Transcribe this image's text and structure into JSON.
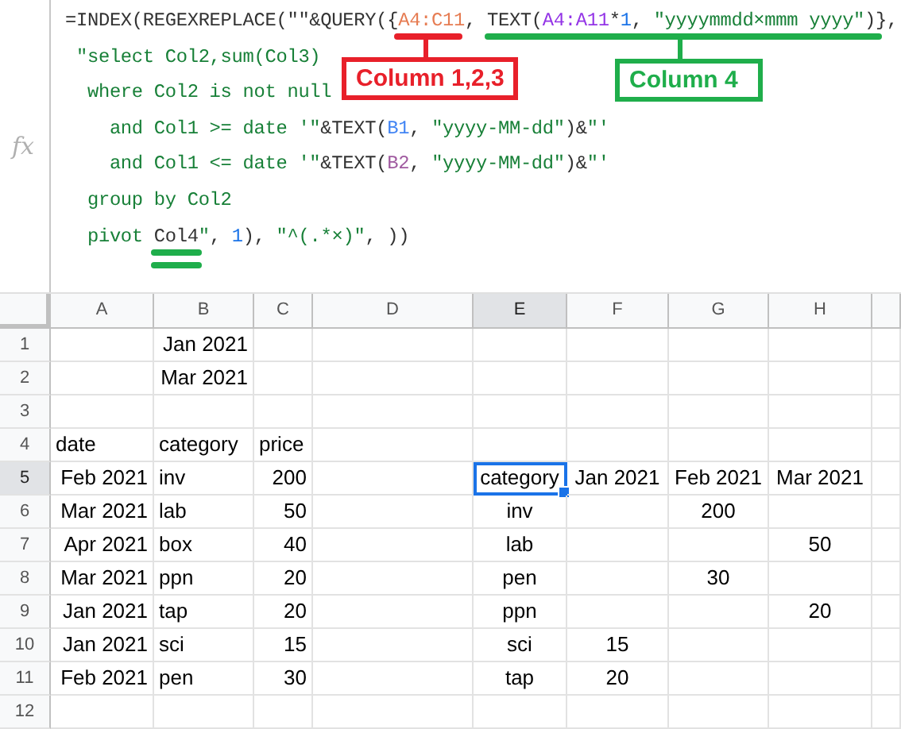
{
  "formula_bar": {
    "icon_label": "fx",
    "lines": [
      [
        {
          "kind": "text",
          "text": "=INDEX(REGEXREPLACE(\"\"&QUERY({"
        },
        {
          "kind": "range",
          "text": "A4:C11",
          "color": "#e67c52"
        },
        {
          "kind": "text",
          "text": ", TEXT("
        },
        {
          "kind": "range",
          "text": "A4:A11",
          "color": "#9334e6"
        },
        {
          "kind": "text",
          "text": "*"
        },
        {
          "kind": "number",
          "text": "1"
        },
        {
          "kind": "text",
          "text": ", "
        },
        {
          "kind": "string",
          "text": "\"yyyymmdd×mmm yyyy\""
        },
        {
          "kind": "text",
          "text": ")},"
        }
      ],
      [
        {
          "kind": "string",
          "text": " \"select Col2,sum(Col3)"
        }
      ],
      [
        {
          "kind": "string",
          "text": "  where Col2 is not null"
        }
      ],
      [
        {
          "kind": "string",
          "text": "    and Col1 >= date '\""
        },
        {
          "kind": "text",
          "text": "&TEXT("
        },
        {
          "kind": "range",
          "text": "B1",
          "color": "#4285f4"
        },
        {
          "kind": "text",
          "text": ", "
        },
        {
          "kind": "string",
          "text": "\"yyyy-MM-dd\""
        },
        {
          "kind": "text",
          "text": ")&"
        },
        {
          "kind": "string",
          "text": "\"'"
        }
      ],
      [
        {
          "kind": "string",
          "text": "    and Col1 <= date '\""
        },
        {
          "kind": "text",
          "text": "&TEXT("
        },
        {
          "kind": "range",
          "text": "B2",
          "color": "#a05ba0"
        },
        {
          "kind": "text",
          "text": ", "
        },
        {
          "kind": "string",
          "text": "\"yyyy-MM-dd\""
        },
        {
          "kind": "text",
          "text": ")&"
        },
        {
          "kind": "string",
          "text": "\"'"
        }
      ],
      [
        {
          "kind": "string",
          "text": "  group by Col2"
        }
      ],
      [
        {
          "kind": "string",
          "text": "  pivot "
        },
        {
          "kind": "text",
          "text": "Col4"
        },
        {
          "kind": "string",
          "text": "\""
        },
        {
          "kind": "text",
          "text": ", "
        },
        {
          "kind": "number",
          "text": "1"
        },
        {
          "kind": "text",
          "text": "), "
        },
        {
          "kind": "string",
          "text": "\"^(.*×)\""
        },
        {
          "kind": "text",
          "text": ", ))"
        }
      ]
    ],
    "annotations": [
      {
        "label": "Column 1,2,3",
        "color": "#e8202a"
      },
      {
        "label": "Column 4",
        "color": "#1fae4b"
      }
    ]
  },
  "columns": [
    {
      "label": "A",
      "selected": false
    },
    {
      "label": "B",
      "selected": false
    },
    {
      "label": "C",
      "selected": false
    },
    {
      "label": "D",
      "selected": false
    },
    {
      "label": "E",
      "selected": true
    },
    {
      "label": "F",
      "selected": false
    },
    {
      "label": "G",
      "selected": false
    },
    {
      "label": "H",
      "selected": false
    }
  ],
  "rows": [
    {
      "number": "1",
      "selected": false,
      "cells": [
        {
          "selected": false
        },
        {
          "text": "Jan 2021",
          "kind": "date",
          "selected": false
        },
        {
          "selected": false
        },
        {
          "selected": false
        },
        {
          "selected": false
        },
        {
          "selected": false
        },
        {
          "selected": false
        },
        {
          "selected": false
        }
      ]
    },
    {
      "number": "2",
      "selected": false,
      "cells": [
        {
          "selected": false
        },
        {
          "text": "Mar 2021",
          "kind": "date",
          "selected": false
        },
        {
          "selected": false
        },
        {
          "selected": false
        },
        {
          "selected": false
        },
        {
          "selected": false
        },
        {
          "selected": false
        },
        {
          "selected": false
        }
      ]
    },
    {
      "number": "3",
      "selected": false,
      "cells": [
        {
          "selected": false
        },
        {
          "selected": false
        },
        {
          "selected": false
        },
        {
          "selected": false
        },
        {
          "selected": false
        },
        {
          "selected": false
        },
        {
          "selected": false
        },
        {
          "selected": false
        }
      ]
    },
    {
      "number": "4",
      "selected": false,
      "cells": [
        {
          "text": "date",
          "kind": "text",
          "selected": false
        },
        {
          "text": "category",
          "kind": "text",
          "selected": false
        },
        {
          "text": "price",
          "kind": "text",
          "selected": false
        },
        {
          "selected": false
        },
        {
          "selected": false
        },
        {
          "selected": false
        },
        {
          "selected": false
        },
        {
          "selected": false
        }
      ]
    },
    {
      "number": "5",
      "selected": true,
      "cells": [
        {
          "text": "Feb 2021",
          "kind": "date",
          "selected": false
        },
        {
          "text": "inv",
          "kind": "text",
          "selected": false
        },
        {
          "text": "200",
          "kind": "number",
          "selected": false
        },
        {
          "selected": false
        },
        {
          "text": "category",
          "kind": "pivot",
          "selected": true
        },
        {
          "text": "Jan 2021",
          "kind": "pivot",
          "selected": false
        },
        {
          "text": "Feb 2021",
          "kind": "pivot",
          "selected": false
        },
        {
          "text": "Mar 2021",
          "kind": "pivot",
          "selected": false
        }
      ]
    },
    {
      "number": "6",
      "selected": false,
      "cells": [
        {
          "text": "Mar 2021",
          "kind": "date",
          "selected": false
        },
        {
          "text": "lab",
          "kind": "text",
          "selected": false
        },
        {
          "text": "50",
          "kind": "number",
          "selected": false
        },
        {
          "selected": false
        },
        {
          "text": "inv",
          "kind": "pivot",
          "selected": false
        },
        {
          "selected": false
        },
        {
          "text": "200",
          "kind": "pivot",
          "selected": false
        },
        {
          "selected": false
        }
      ]
    },
    {
      "number": "7",
      "selected": false,
      "cells": [
        {
          "text": "Apr 2021",
          "kind": "date",
          "selected": false
        },
        {
          "text": "box",
          "kind": "text",
          "selected": false
        },
        {
          "text": "40",
          "kind": "number",
          "selected": false
        },
        {
          "selected": false
        },
        {
          "text": "lab",
          "kind": "pivot",
          "selected": false
        },
        {
          "selected": false
        },
        {
          "selected": false
        },
        {
          "text": "50",
          "kind": "pivot",
          "selected": false
        }
      ]
    },
    {
      "number": "8",
      "selected": false,
      "cells": [
        {
          "text": "Mar 2021",
          "kind": "date",
          "selected": false
        },
        {
          "text": "ppn",
          "kind": "text",
          "selected": false
        },
        {
          "text": "20",
          "kind": "number",
          "selected": false
        },
        {
          "selected": false
        },
        {
          "text": "pen",
          "kind": "pivot",
          "selected": false
        },
        {
          "selected": false
        },
        {
          "text": "30",
          "kind": "pivot",
          "selected": false
        },
        {
          "selected": false
        }
      ]
    },
    {
      "number": "9",
      "selected": false,
      "cells": [
        {
          "text": "Jan 2021",
          "kind": "date",
          "selected": false
        },
        {
          "text": "tap",
          "kind": "text",
          "selected": false
        },
        {
          "text": "20",
          "kind": "number",
          "selected": false
        },
        {
          "selected": false
        },
        {
          "text": "ppn",
          "kind": "pivot",
          "selected": false
        },
        {
          "selected": false
        },
        {
          "selected": false
        },
        {
          "text": "20",
          "kind": "pivot",
          "selected": false
        }
      ]
    },
    {
      "number": "10",
      "selected": false,
      "cells": [
        {
          "text": "Jan 2021",
          "kind": "date",
          "selected": false
        },
        {
          "text": "sci",
          "kind": "text",
          "selected": false
        },
        {
          "text": "15",
          "kind": "number",
          "selected": false
        },
        {
          "selected": false
        },
        {
          "text": "sci",
          "kind": "pivot",
          "selected": false
        },
        {
          "text": "15",
          "kind": "pivot",
          "selected": false
        },
        {
          "selected": false
        },
        {
          "selected": false
        }
      ]
    },
    {
      "number": "11",
      "selected": false,
      "cells": [
        {
          "text": "Feb 2021",
          "kind": "date",
          "selected": false
        },
        {
          "text": "pen",
          "kind": "text",
          "selected": false
        },
        {
          "text": "30",
          "kind": "number",
          "selected": false
        },
        {
          "selected": false
        },
        {
          "text": "tap",
          "kind": "pivot",
          "selected": false
        },
        {
          "text": "20",
          "kind": "pivot",
          "selected": false
        },
        {
          "selected": false
        },
        {
          "selected": false
        }
      ]
    },
    {
      "number": "12",
      "selected": false,
      "cells": [
        {
          "selected": false
        },
        {
          "selected": false
        },
        {
          "selected": false
        },
        {
          "selected": false
        },
        {
          "selected": false
        },
        {
          "selected": false
        },
        {
          "selected": false
        },
        {
          "selected": false
        }
      ]
    }
  ]
}
